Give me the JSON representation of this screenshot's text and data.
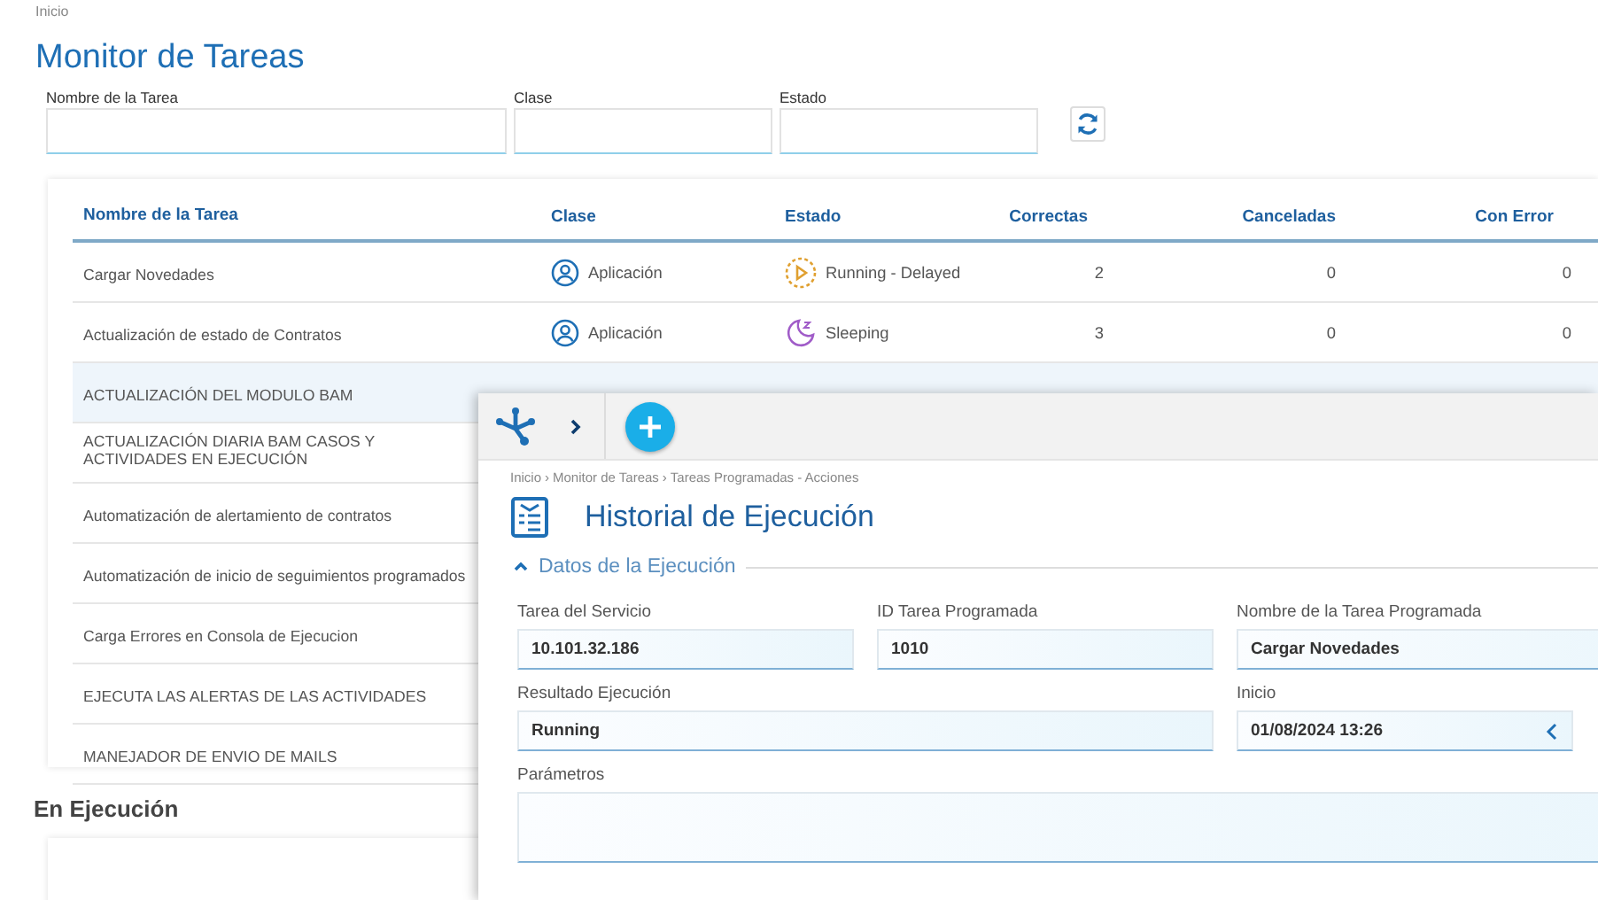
{
  "breadcrumb": "Inicio",
  "title": "Monitor de Tareas",
  "filters": [
    {
      "label": "Nombre de la Tarea"
    },
    {
      "label": "Clase"
    },
    {
      "label": "Estado"
    }
  ],
  "table": {
    "columns": [
      "Nombre de la Tarea",
      "Clase",
      "Estado",
      "Correctas",
      "Canceladas",
      "Con Error"
    ],
    "rows": [
      {
        "name": "Cargar Novedades",
        "clase": "Aplicación",
        "estado": "Running - Delayed",
        "kind": "running",
        "correctas": "2",
        "canceladas": "0",
        "con_error": "0",
        "selected": false
      },
      {
        "name": "Actualización de estado de Contratos",
        "clase": "Aplicación",
        "estado": "Sleeping",
        "kind": "sleeping",
        "correctas": "3",
        "canceladas": "0",
        "con_error": "0",
        "selected": false
      },
      {
        "name": "ACTUALIZACIÓN DEL MODULO BAM",
        "selected": true
      },
      {
        "name": "ACTUALIZACIÓN DIARIA BAM CASOS Y ACTIVIDADES EN EJECUCIÓN",
        "selected": false
      },
      {
        "name": "Automatización de alertamiento de contratos",
        "selected": false
      },
      {
        "name": "Automatización de inicio de seguimientos programados",
        "selected": false
      },
      {
        "name": "Carga Errores en Consola de Ejecucion",
        "selected": false
      },
      {
        "name": "EJECUTA LAS ALERTAS DE LAS ACTIVIDADES",
        "selected": false
      },
      {
        "name": "MANEJADOR DE ENVIO DE MAILS",
        "selected": false
      }
    ]
  },
  "running_section": {
    "title": "En Ejecución"
  },
  "panel": {
    "breadcrumb": [
      "Inicio",
      "Monitor de Tareas",
      "Tareas Programadas - Acciones"
    ],
    "separator": "›",
    "title": "Historial de Ejecución",
    "section": {
      "title": "Datos de la Ejecución",
      "expanded": true
    },
    "fields": [
      {
        "label": "Tarea del Servicio",
        "value": "10.101.32.186",
        "kind": "text"
      },
      {
        "label": "ID Tarea Programada",
        "value": "1010",
        "kind": "text"
      },
      {
        "label": "Nombre de la Tarea Programada",
        "value": "Cargar Novedades",
        "kind": "text"
      },
      {
        "label": "Resultado Ejecución",
        "value": "Running",
        "kind": "wide"
      },
      {
        "label": "Inicio",
        "value": "01/08/2024 13:26",
        "kind": "date"
      },
      {
        "label": "Parámetros",
        "kind": "area"
      }
    ]
  }
}
